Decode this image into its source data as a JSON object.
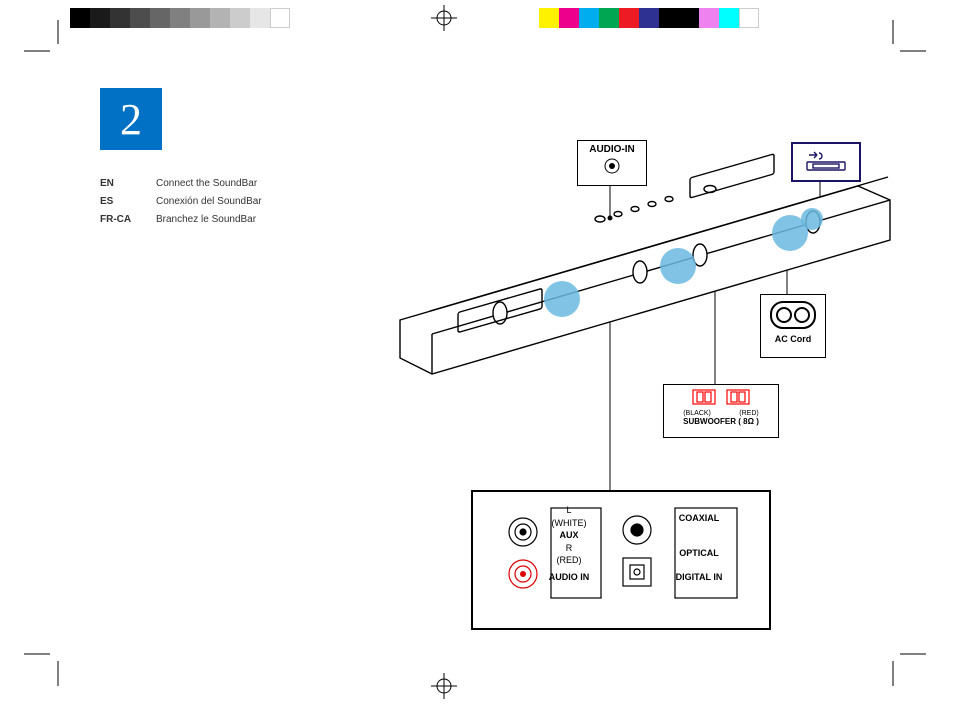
{
  "step_number": "2",
  "languages": [
    {
      "code": "EN",
      "text": "Connect the SoundBar"
    },
    {
      "code": "ES",
      "text": "Conexión del SoundBar"
    },
    {
      "code": "FR-CA",
      "text": "Branchez le SoundBar"
    }
  ],
  "callouts": {
    "audio_in": {
      "title": "AUDIO-IN"
    },
    "usb": {
      "symbol": "USB"
    },
    "ac_cord": {
      "label": "AC Cord"
    },
    "subwoofer": {
      "left": "(BLACK)",
      "right": "(RED)",
      "label": "SUBWOOFER ( 8Ω )"
    },
    "io_panel": {
      "aux_top": "L",
      "aux_white": "(WHITE)",
      "aux_mid": "AUX",
      "aux_r": "R",
      "aux_red": "(RED)",
      "aux_bottom": "AUDIO IN",
      "coaxial": "COAXIAL",
      "optical": "OPTICAL",
      "digital": "DIGITAL IN"
    }
  }
}
